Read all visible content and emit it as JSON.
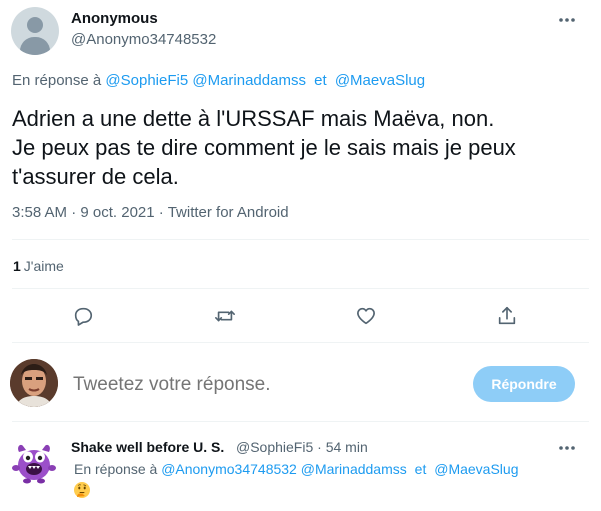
{
  "tweet": {
    "author_name": "Anonymous",
    "author_handle": "@Anonymo34748532",
    "reply_prefix": "En réponse à",
    "mentions": [
      "@SophieFi5",
      "@Marinaddamss",
      "@MaevaSlug"
    ],
    "mention_separator": "et",
    "text_lines": [
      "Adrien a une dette à l'URSSAF mais Maëva, non.",
      "Je peux pas te dire comment je le sais mais je peux",
      "t'assurer de cela."
    ],
    "time": "3:58 AM",
    "date": "9 oct. 2021",
    "source": "Twitter for Android",
    "meta_separator": "·",
    "likes_count": "1",
    "likes_label": "J'aime"
  },
  "actions": {
    "reply_icon": "reply-icon",
    "retweet_icon": "retweet-icon",
    "like_icon": "heart-icon",
    "share_icon": "share-icon"
  },
  "compose": {
    "placeholder": "Tweetez votre réponse.",
    "button_label": "Répondre"
  },
  "reply": {
    "author_name": "Shake well before U. S.",
    "author_handle": "@SophieFi5",
    "separator": "·",
    "time": "54 min",
    "reply_prefix": "En réponse à",
    "mentions": [
      "@Anonymo34748532",
      "@Marinaddamss",
      "@MaevaSlug"
    ],
    "mention_separator": "et",
    "emoji": "thinking-face"
  },
  "colors": {
    "accent": "#1d9bf0",
    "button_disabled": "#8ecdf7",
    "secondary_text": "#536471",
    "divider": "#eff3f4"
  }
}
